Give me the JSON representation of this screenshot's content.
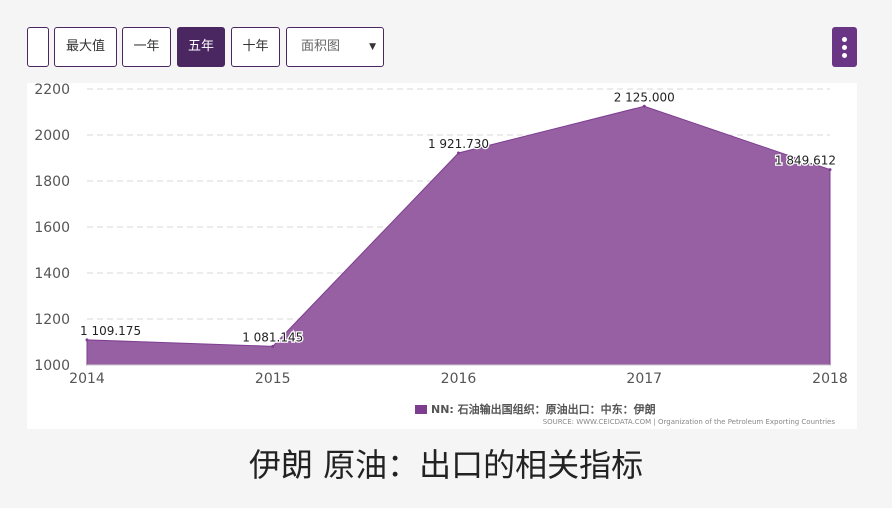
{
  "toolbar": {
    "buttons": [
      "",
      "最大值",
      "一年",
      "五年",
      "十年"
    ],
    "active_button": "五年",
    "chart_type_select": "面积图",
    "menu_icon": "vertical-ellipsis-icon"
  },
  "colors": {
    "accent": "#4a2760",
    "area_fill": "#9660a3",
    "area_stroke": "#7e3e90",
    "grid": "#d9d9d9"
  },
  "chart_data": {
    "type": "area",
    "x": [
      "2014",
      "2015",
      "2016",
      "2017",
      "2018"
    ],
    "series": [
      {
        "name": "NN: 石油输出国组织：原油出口：中东：伊朗",
        "values": [
          1109.175,
          1081.145,
          1921.73,
          2125.0,
          1849.612
        ],
        "labels": [
          "1 109.175",
          "1 081.145",
          "1 921.730",
          "2 125.000",
          "1 849.612"
        ]
      }
    ],
    "y_ticks": [
      "1000",
      "1200",
      "1400",
      "1600",
      "1800",
      "2000",
      "2200"
    ],
    "ylim": [
      1000,
      2200
    ],
    "grid": true,
    "legend": "bottom-center"
  },
  "legend_text": "NN: 石油输出国组织：原油出口：中东：伊朗",
  "source": "SOURCE: WWW.CEICDATA.COM | Organization of the Petroleum Exporting Countries",
  "caption": "伊朗 原油：出口的相关指标"
}
